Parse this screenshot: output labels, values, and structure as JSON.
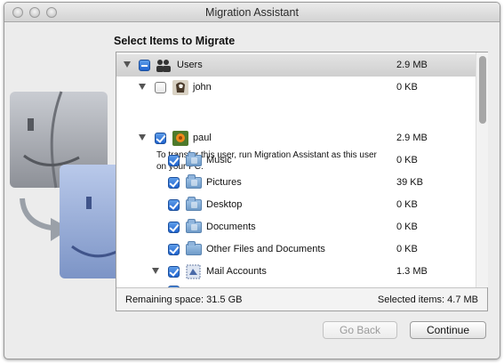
{
  "window": {
    "title": "Migration Assistant"
  },
  "section_title": "Select Items to Migrate",
  "tree": [
    {
      "id": "users",
      "label": "Users",
      "size": "2.9 MB",
      "state": "mixed",
      "icon": "users-group-icon"
    },
    {
      "id": "john",
      "label": "john",
      "size": "0 KB",
      "state": "unchecked",
      "icon": "eagle-avatar-icon",
      "note": "To transfer this user, run Migration Assistant as this user on your PC."
    },
    {
      "id": "paul",
      "label": "paul",
      "size": "2.9 MB",
      "state": "checked",
      "icon": "flower-avatar-icon"
    },
    {
      "id": "music",
      "label": "Music",
      "size": "0 KB",
      "state": "checked",
      "icon": "music-folder-icon"
    },
    {
      "id": "pictures",
      "label": "Pictures",
      "size": "39 KB",
      "state": "checked",
      "icon": "pictures-folder-icon"
    },
    {
      "id": "desktop",
      "label": "Desktop",
      "size": "0 KB",
      "state": "checked",
      "icon": "desktop-folder-icon"
    },
    {
      "id": "documents",
      "label": "Documents",
      "size": "0 KB",
      "state": "checked",
      "icon": "documents-folder-icon"
    },
    {
      "id": "other",
      "label": "Other Files and Documents",
      "size": "0 KB",
      "state": "checked",
      "icon": "folder-icon"
    },
    {
      "id": "mail",
      "label": "Mail Accounts",
      "size": "1.3 MB",
      "state": "checked",
      "icon": "mail-stamp-icon"
    }
  ],
  "footer": {
    "remaining": "Remaining space: 31.5 GB",
    "selected": "Selected items: 4.7 MB"
  },
  "buttons": {
    "back": "Go Back",
    "continue": "Continue"
  }
}
